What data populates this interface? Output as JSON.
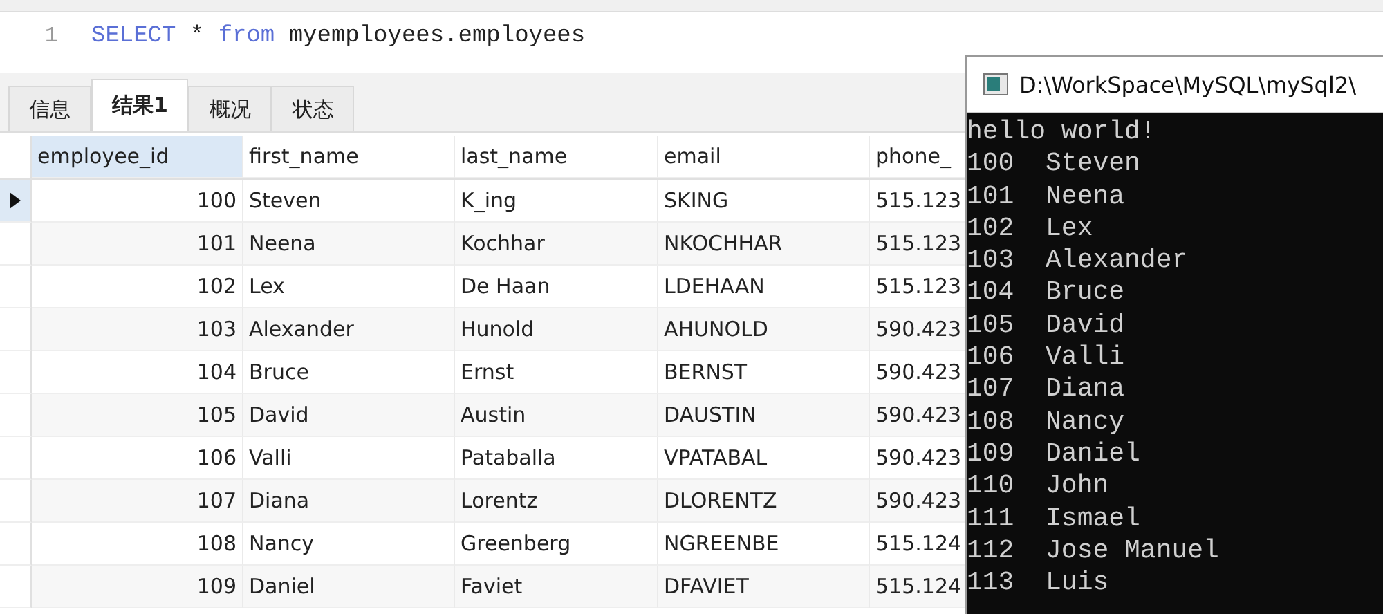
{
  "editor": {
    "lines": [
      {
        "number": "1",
        "tokens": [
          {
            "kind": "keyword",
            "text": "SELECT"
          },
          {
            "kind": "plain",
            "text": "*"
          },
          {
            "kind": "keyword",
            "text": "from"
          },
          {
            "kind": "plain",
            "text": "myemployees.employees"
          }
        ]
      }
    ]
  },
  "tabs": [
    {
      "label": "信息",
      "selected": false
    },
    {
      "label": "结果1",
      "selected": true
    },
    {
      "label": "概况",
      "selected": false
    },
    {
      "label": "状态",
      "selected": false
    }
  ],
  "table": {
    "columns": [
      {
        "label": "employee_id",
        "selected": true
      },
      {
        "label": "first_name",
        "selected": false
      },
      {
        "label": "last_name",
        "selected": false
      },
      {
        "label": "email",
        "selected": false
      },
      {
        "label": "phone_",
        "selected": false
      }
    ],
    "rows": [
      {
        "selected": true,
        "cells": [
          "100",
          "Steven",
          "K_ing",
          "SKING",
          "515.123"
        ]
      },
      {
        "selected": false,
        "cells": [
          "101",
          "Neena",
          "Kochhar",
          "NKOCHHAR",
          "515.123"
        ]
      },
      {
        "selected": false,
        "cells": [
          "102",
          "Lex",
          "De Haan",
          "LDEHAAN",
          "515.123"
        ]
      },
      {
        "selected": false,
        "cells": [
          "103",
          "Alexander",
          "Hunold",
          "AHUNOLD",
          "590.423"
        ]
      },
      {
        "selected": false,
        "cells": [
          "104",
          "Bruce",
          "Ernst",
          "BERNST",
          "590.423"
        ]
      },
      {
        "selected": false,
        "cells": [
          "105",
          "David",
          "Austin",
          "DAUSTIN",
          "590.423"
        ]
      },
      {
        "selected": false,
        "cells": [
          "106",
          "Valli",
          "Pataballa",
          "VPATABAL",
          "590.423"
        ]
      },
      {
        "selected": false,
        "cells": [
          "107",
          "Diana",
          "Lorentz",
          "DLORENTZ",
          "590.423"
        ]
      },
      {
        "selected": false,
        "cells": [
          "108",
          "Nancy",
          "Greenberg",
          "NGREENBE",
          "515.124"
        ]
      },
      {
        "selected": false,
        "cells": [
          "109",
          "Daniel",
          "Faviet",
          "DFAVIET",
          "515.124"
        ]
      }
    ]
  },
  "console": {
    "title": "D:\\WorkSpace\\MySQL\\mySql2\\",
    "lines": [
      "hello world!",
      "100  Steven",
      "101  Neena",
      "102  Lex",
      "103  Alexander",
      "104  Bruce",
      "105  David",
      "106  Valli",
      "107  Diana",
      "108  Nancy",
      "109  Daniel",
      "110  John",
      "111  Ismael",
      "112  Jose Manuel",
      "113  Luis"
    ]
  }
}
